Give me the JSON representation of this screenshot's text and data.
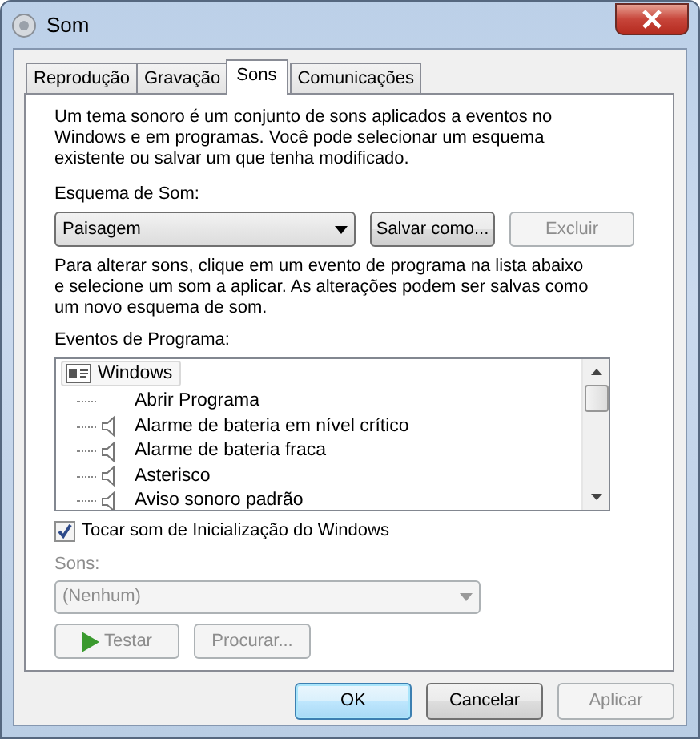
{
  "window": {
    "title": "Som"
  },
  "tabs": [
    {
      "label": "Reprodução",
      "selected": false
    },
    {
      "label": "Gravação",
      "selected": false
    },
    {
      "label": "Sons",
      "selected": true
    },
    {
      "label": "Comunicações",
      "selected": false
    }
  ],
  "intro": "Um tema sonoro é um conjunto de sons aplicados a eventos no Windows e em programas. Você pode selecionar um esquema existente ou salvar um que tenha modificado.",
  "scheme": {
    "label": "Esquema de Som:",
    "value": "Paisagem",
    "buttons": [
      {
        "label": "Salvar como...",
        "disabled": false
      },
      {
        "label": "Excluir",
        "disabled": true
      }
    ]
  },
  "instructions": "Para alterar sons, clique em um evento de programa na lista abaixo e selecione um som a aplicar. As alterações podem ser salvas como um novo esquema de som.",
  "events": {
    "label": "Eventos de Programa:",
    "tree": [
      {
        "label": "Windows",
        "selected": true,
        "children": [
          {
            "label": "Abrir Programa",
            "kind": "silent",
            "selected": false
          },
          {
            "label": "Alarme de bateria em nível crítico",
            "kind": "sound",
            "selected": false
          },
          {
            "label": "Alarme de bateria fraca",
            "kind": "sound",
            "selected": false
          },
          {
            "label": "Asterisco",
            "kind": "sound",
            "selected": false
          },
          {
            "label": "Aviso sonoro padrão",
            "kind": "sound",
            "selected": false
          }
        ]
      }
    ]
  },
  "startup_sound": {
    "label": "Tocar som de Inicialização do Windows",
    "checked": true
  },
  "sounds": {
    "label": "Sons:",
    "value": "(Nenhum)",
    "disabled": true
  },
  "sound_buttons": [
    {
      "label": "Testar",
      "kind": "play",
      "disabled": true
    },
    {
      "label": "Procurar...",
      "kind": "plain",
      "disabled": true
    }
  ],
  "footer_buttons": [
    {
      "label": "OK",
      "default": true,
      "disabled": false
    },
    {
      "label": "Cancelar",
      "default": false,
      "disabled": false
    },
    {
      "label": "Aplicar",
      "default": false,
      "disabled": true
    }
  ]
}
